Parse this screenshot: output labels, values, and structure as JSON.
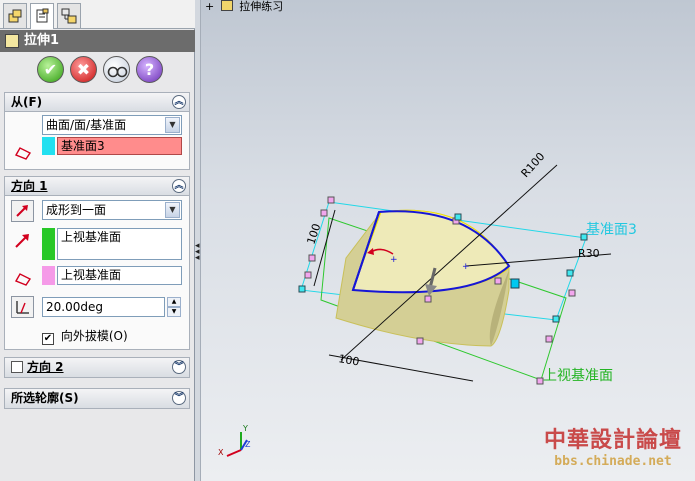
{
  "tabs": [
    {
      "name": "feature-manager",
      "active": false
    },
    {
      "name": "property-manager",
      "active": true
    },
    {
      "name": "configuration-manager",
      "active": false
    }
  ],
  "feature_title": "拉伸1",
  "actions": {
    "ok_icon": "check-icon",
    "cancel_icon": "x-icon",
    "preview_icon": "glasses-icon",
    "help_icon": "?"
  },
  "from_group": {
    "header": "从(F)",
    "type_value": "曲面/面/基准面",
    "entity_value": "基准面3",
    "entity_color": "#ff8c8c",
    "swatch_color": "#22e0f0"
  },
  "direction1": {
    "header": "方向 1",
    "end_condition": "成形到一面",
    "face_value": "上视基准面",
    "face_swatch": "#28c828",
    "vector_value": "上视基准面",
    "vector_swatch": "#f59ae8",
    "draft_value": "20.00deg",
    "draft_outward_label": "向外拔模(O)",
    "draft_outward_checked": true
  },
  "direction2": {
    "header": "方向 2",
    "checked": false
  },
  "contours": {
    "header": "所选轮廓(S)"
  },
  "viewport": {
    "tree_label": "拉伸练习",
    "dims": {
      "r100": "R100",
      "r30": "R30",
      "d100_vertical": "100",
      "d100_horizontal": "100"
    },
    "plane_labels": {
      "plane3": "基准面3",
      "top_plane": "上视基准面"
    },
    "triad": {
      "x": "X",
      "y": "Y",
      "z": "Z"
    }
  },
  "watermark": {
    "title": "中華設計論壇",
    "url": "bbs.chinade.net"
  }
}
